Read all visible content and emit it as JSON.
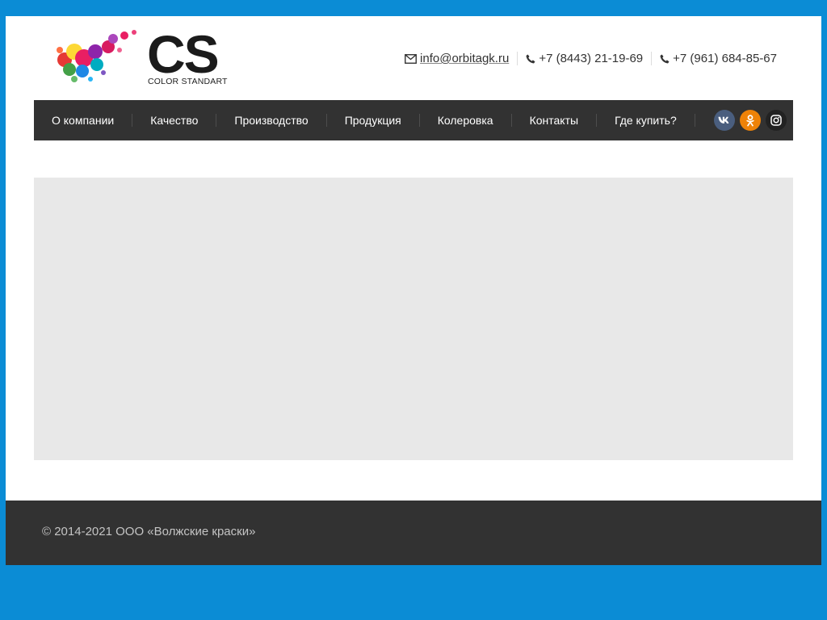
{
  "header": {
    "logo": {
      "mark": "CS",
      "caption": "COLOR STANDART"
    },
    "contacts": {
      "email": "info@orbitagk.ru",
      "phone1": "+7 (8443) 21-19-69",
      "phone2": "+7 (961) 684-85-67"
    }
  },
  "nav": {
    "items": [
      "О компании",
      "Качество",
      "Производство",
      "Продукция",
      "Колеровка",
      "Контакты",
      "Где купить?"
    ],
    "social": [
      "vk-icon",
      "odnoklassniki-icon",
      "instagram-icon"
    ]
  },
  "footer": {
    "copyright": "© 2014-2021 ООО «Волжские краски»"
  },
  "colors": {
    "page_background": "#0b8cd5",
    "nav_background": "#323232",
    "banner_background": "#e8e8e8",
    "vk": "#4a5e7e",
    "ok": "#ee8208",
    "instagram": "#222222"
  }
}
